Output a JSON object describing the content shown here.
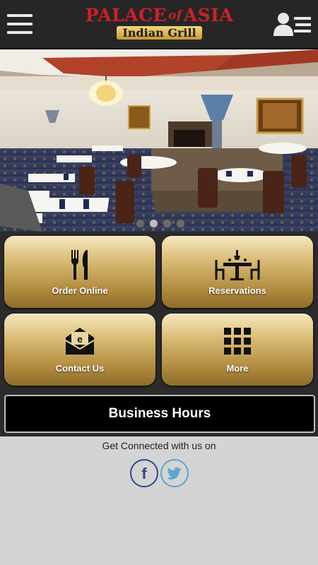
{
  "header": {
    "logo_title_left": "PALACE",
    "logo_title_of": "of",
    "logo_title_right": "ASIA",
    "logo_subtitle": "Indian Grill"
  },
  "hero": {
    "slides": 4,
    "active_slide": 1
  },
  "tiles": [
    {
      "label": "Order Online",
      "icon": "fork-knife-icon"
    },
    {
      "label": "Reservations",
      "icon": "dining-table-icon"
    },
    {
      "label": "Contact Us",
      "icon": "envelope-icon"
    },
    {
      "label": "More",
      "icon": "grid-icon"
    }
  ],
  "business_hours_label": "Business Hours",
  "social": {
    "title": "Get Connected with us on",
    "facebook_glyph": "f",
    "items": [
      "facebook-icon",
      "twitter-icon"
    ]
  },
  "colors": {
    "header_bg": "#262626",
    "logo_red": "#d01f26",
    "gold": "#d8bb73",
    "tile_area_bg": "#2b2b2b",
    "footer_bg": "#d4d4d4"
  }
}
